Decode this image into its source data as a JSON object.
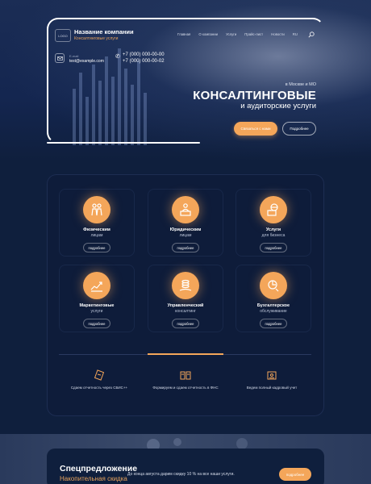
{
  "header": {
    "logo_text": "LOGO",
    "company_name": "Название компании",
    "company_subtitle": "Консалтинговые услуги",
    "nav": [
      "Главная",
      "О компании",
      "Услуги",
      "Прайс-лист",
      "Новости",
      "RU"
    ],
    "email_label": "E-mail",
    "email": "test@example.com",
    "phone1": "+7 (000) 000-00-00",
    "phone2": "+7 (000) 000-00-02"
  },
  "hero": {
    "location": "в Москве и МО",
    "title": "КОНСАЛТИНГОВЫЕ",
    "subtitle": "и аудиторские услуги",
    "btn_primary": "Связаться с нами",
    "btn_secondary": "Подробнее"
  },
  "services": [
    {
      "title": "Физическим",
      "sub": "лицам",
      "btn": "подробнее",
      "icon": "people-icon"
    },
    {
      "title": "Юридическим",
      "sub": "лицам",
      "btn": "подробнее",
      "icon": "person-desk-icon"
    },
    {
      "title": "Услуги",
      "sub": "для бизнеса",
      "btn": "подробнее",
      "icon": "briefcase-globe-icon"
    },
    {
      "title": "Маркетинговые",
      "sub": "услуги",
      "btn": "подробнее",
      "icon": "growth-chart-icon"
    },
    {
      "title": "Управленческий",
      "sub": "консалтинг",
      "btn": "подробнее",
      "icon": "coins-hand-icon"
    },
    {
      "title": "Бухгалтерское",
      "sub": "обслуживание",
      "btn": "подробнее",
      "icon": "accounting-icon"
    }
  ],
  "features": [
    {
      "text": "Сдаем отчетность через СБИС++",
      "icon": "report-icon"
    },
    {
      "text": "Формируем и сдаем отчетность в ФНС",
      "icon": "documents-icon"
    },
    {
      "text": "Ведем полный кадровый учет",
      "icon": "hr-icon"
    }
  ],
  "offer": {
    "title": "Спецпредложение",
    "subtitle": "Накопительная скидка",
    "text": "До конца августа дарим скидку 10 % на все наши услуги.",
    "btn": "подробнее"
  },
  "colors": {
    "accent": "#f4a65a",
    "background": "#0f1f3d"
  }
}
